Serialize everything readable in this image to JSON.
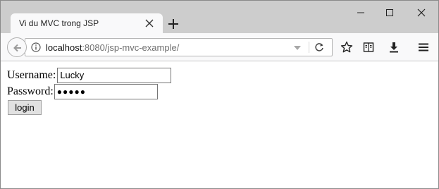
{
  "browser": {
    "tab": {
      "title": "Vi du MVC trong JSP"
    },
    "address_bar": {
      "host": "localhost",
      "rest": ":8080/jsp-mvc-example/"
    }
  },
  "icons": {
    "tab_close": "close-icon",
    "new_tab": "plus-icon",
    "window_minimize": "minimize-icon",
    "window_maximize": "maximize-icon",
    "window_close": "close-icon",
    "back": "arrow-left-icon",
    "site_info": "info-icon",
    "url_dropdown": "chevron-down-icon",
    "reload": "reload-icon",
    "bookmark": "star-icon",
    "reading_list": "reader-view-icon",
    "downloads": "download-icon",
    "menu": "hamburger-menu-icon"
  },
  "form": {
    "username_label": "Username:",
    "username_value": "Lucky",
    "password_label": "Password:",
    "password_masked": "●●●●●",
    "login_label": "login"
  },
  "colors": {
    "tabstrip": "#cdcdcd",
    "toolbar": "#f9f9fa",
    "button": "#e1e1e1"
  }
}
